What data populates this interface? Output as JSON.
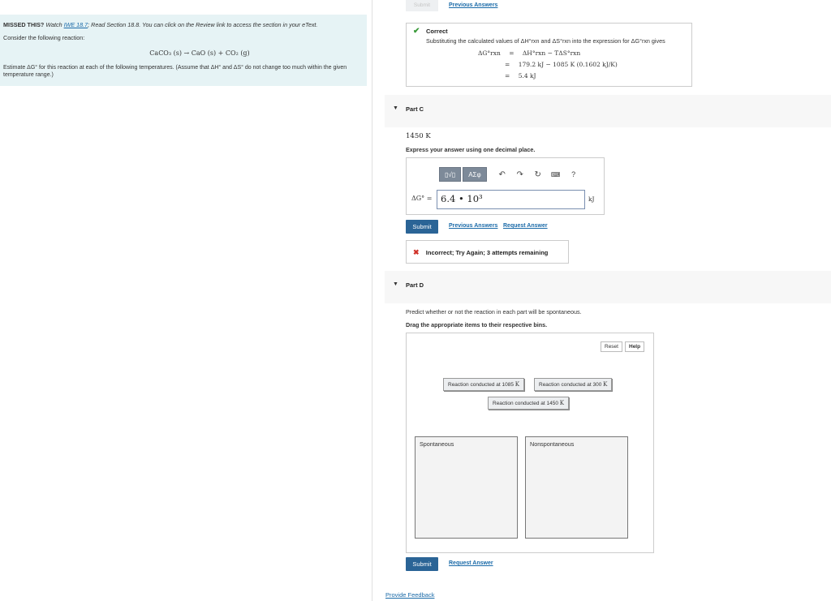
{
  "left": {
    "missed_label": "MISSED THIS?",
    "watch_text": "Watch",
    "iwe_link": "IWE 18.7",
    "read_text": "; Read Section 18.8. You can click on the Review link to access the section in your eText.",
    "consider": "Consider the following reaction:",
    "reaction": "CaCO₃ (s) → CaO (s) + CO₂ (g)",
    "estimate": "Estimate ΔG° for this reaction at each of the following temperatures. (Assume that ΔH° and ΔS° do not change too much within the given temperature range.)"
  },
  "top": {
    "submit_label": "Submit",
    "prev_answers": "Previous Answers"
  },
  "correct": {
    "title": "Correct",
    "text": "Substituting the calculated values of ΔH°rxn and ΔS°rxn into the expression for ΔG°rxn gives",
    "line1_lhs": "ΔG°rxn",
    "line1_rhs": "ΔH°rxn − TΔS°rxn",
    "line2_rhs": "179.2 kJ − 1085 K (0.1602 kJ/K)",
    "line3_rhs": "5.4 kJ",
    "eq": "="
  },
  "partC": {
    "label": "Part C",
    "temperature": "1450 K",
    "instruction": "Express your answer using one decimal place.",
    "toolbar": {
      "templates_btn": "▯√▯",
      "greek_btn": "ΑΣφ",
      "help": "?"
    },
    "dg_label": "ΔG° =",
    "answer_value": "6.4 • 10³",
    "unit": "kJ",
    "submit": "Submit",
    "prev_answers": "Previous Answers",
    "request_answer": "Request Answer",
    "feedback": "Incorrect; Try Again; 3 attempts remaining"
  },
  "partD": {
    "label": "Part D",
    "predict": "Predict whether or not the reaction in each part will be spontaneous.",
    "drag": "Drag the appropriate items to their respective bins.",
    "reset": "Reset",
    "help": "Help",
    "chips": [
      {
        "text": "Reaction conducted at 1085",
        "unit": "K"
      },
      {
        "text": "Reaction conducted at 300",
        "unit": "K"
      },
      {
        "text": "Reaction conducted at 1450",
        "unit": "K"
      }
    ],
    "bins": [
      "Spontaneous",
      "Nonspontaneous"
    ],
    "submit": "Submit",
    "request_answer": "Request Answer"
  },
  "footer": {
    "provide_feedback": "Provide Feedback"
  },
  "colors": {
    "accent": "#2a6496",
    "link": "#1a6aa8",
    "correct_green": "#3a9a3a",
    "incorrect_red": "#d0322a",
    "left_panel_bg": "#e6f3f5"
  }
}
